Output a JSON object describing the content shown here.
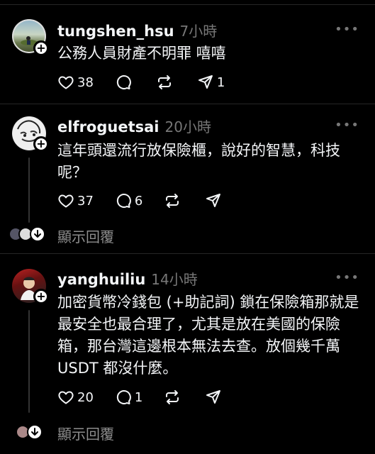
{
  "posts": [
    {
      "username": "tungshen_hsu",
      "time": "7小時",
      "more": "•••",
      "text": "公務人員財產不明罪 嘻嘻",
      "likes": "38",
      "comments": "",
      "reposts": "",
      "shares": "1"
    },
    {
      "username": "elfroguetsai",
      "time": "20小時",
      "more": "•••",
      "text": "這年頭還流行放保險櫃，說好的智慧，科技呢？",
      "likes": "37",
      "comments": "6",
      "reposts": "",
      "shares": ""
    },
    {
      "username": "yanghuiliu",
      "time": "14小時",
      "more": "•••",
      "text": "加密貨幣冷錢包 (+助記詞) 鎖在保險箱那就是最安全也最合理了，尤其是放在美國的保險箱，那台灣這邊根本無法去查。放個幾千萬 USDT 都沒什麼。",
      "likes": "20",
      "comments": "1",
      "reposts": "",
      "shares": ""
    }
  ],
  "show_replies_label": "顯示回覆",
  "colors": {
    "background": "#000000",
    "text": "#f3f5f7",
    "muted": "#777777",
    "divider": "#262626"
  }
}
